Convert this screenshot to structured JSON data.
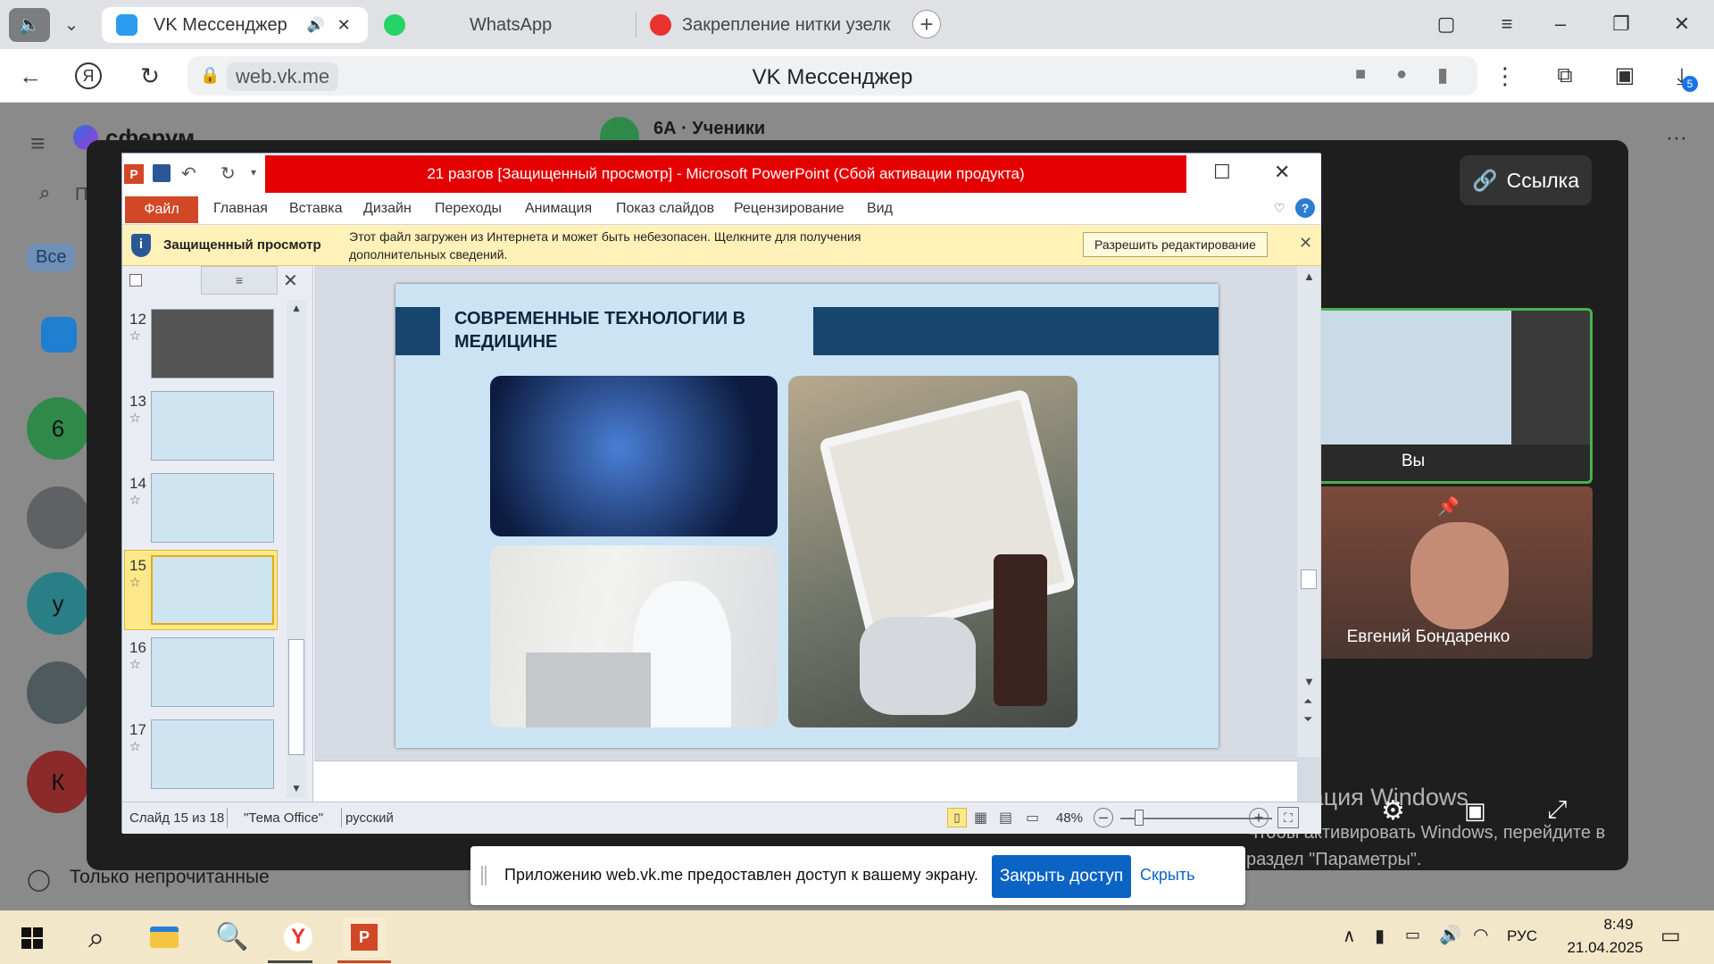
{
  "browser": {
    "tabs": [
      {
        "label": "VK Мессенджер"
      },
      {
        "label": "WhatsApp"
      },
      {
        "label": "Закрепление нитки узелк"
      }
    ],
    "url": "web.vk.me",
    "page_title": "VK Мессенджер",
    "downloads_badge": "5"
  },
  "vk": {
    "logo": "сферум",
    "chat_title": "6А · Ученики",
    "filter_all": "Все",
    "search_placeholder": "П",
    "only_unread": "Только непрочитанные",
    "link_button": "Ссылка",
    "avatar_letters": [
      "6",
      "у",
      "К"
    ],
    "participants": [
      {
        "name": "Вы"
      },
      {
        "name": "Евгений Бондаренко"
      }
    ]
  },
  "ppt": {
    "window_title": "21 разгов [Защищенный просмотр] - Microsoft PowerPoint (Сбой активации продукта)",
    "file_tab": "Файл",
    "ribbon_tabs": [
      "Главная",
      "Вставка",
      "Дизайн",
      "Переходы",
      "Анимация",
      "Показ слайдов",
      "Рецензирование",
      "Вид"
    ],
    "protected_label": "Защищенный просмотр",
    "protected_message": "Этот файл загружен из Интернета и может быть небезопасен. Щелкните для получения дополнительных сведений.",
    "enable_editing": "Разрешить редактирование",
    "thumbnails": [
      {
        "num": "12"
      },
      {
        "num": "13"
      },
      {
        "num": "14"
      },
      {
        "num": "15"
      },
      {
        "num": "16"
      },
      {
        "num": "17"
      }
    ],
    "slide_title_line1": "СОВРЕМЕННЫЕ ТЕХНОЛОГИИ В",
    "slide_title_line2": "МЕДИЦИНЕ",
    "status": {
      "slide": "Слайд 15 из 18",
      "theme": "\"Тема Office\"",
      "lang": "русский",
      "zoom": "48%"
    }
  },
  "windows_activation": {
    "line1": "Активация Windows",
    "line2": "Чтобы активировать Windows, перейдите в",
    "line3": "раздел \"Параметры\"."
  },
  "share_banner": {
    "message": "Приложению web.vk.me предоставлен доступ к вашему экрану.",
    "stop_button": "Закрыть доступ",
    "hide_button": "Скрыть"
  },
  "taskbar": {
    "lang": "РУС",
    "time": "8:49",
    "date": "21.04.2025"
  }
}
